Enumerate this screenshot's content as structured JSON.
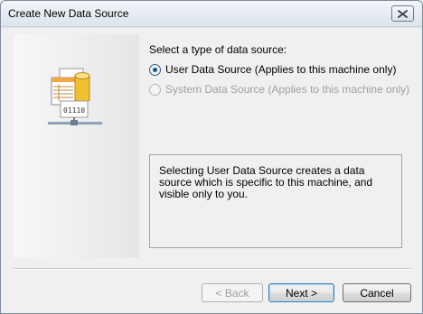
{
  "window": {
    "title": "Create New Data Source"
  },
  "main": {
    "prompt": "Select a type of data source:",
    "options": [
      {
        "label": "User Data Source (Applies to this machine only)",
        "checked": true,
        "enabled": true
      },
      {
        "label": "System Data Source (Applies to this machine only)",
        "checked": false,
        "enabled": false
      }
    ],
    "description": "Selecting User Data Source creates a data source which is specific to this machine, and visible only to you."
  },
  "illustration": {
    "binary_text": "01110"
  },
  "buttons": {
    "back": "< Back",
    "next": "Next >",
    "cancel": "Cancel"
  },
  "icons": {
    "close": "close-icon",
    "illustration": "database-document-icon"
  },
  "colors": {
    "radio_dot": "#1a4f8a",
    "database": "#f0c030",
    "default_button_border": "#3c7fb1"
  }
}
